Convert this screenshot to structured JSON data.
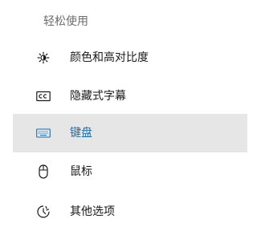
{
  "section": {
    "title": "轻松使用"
  },
  "nav": {
    "items": [
      {
        "label": "颜色和高对比度",
        "icon": "brightness-icon",
        "selected": false
      },
      {
        "label": "隐藏式字幕",
        "icon": "closed-caption-icon",
        "selected": false
      },
      {
        "label": "键盘",
        "icon": "keyboard-icon",
        "selected": true
      },
      {
        "label": "鼠标",
        "icon": "mouse-icon",
        "selected": false
      },
      {
        "label": "其他选项",
        "icon": "other-options-icon",
        "selected": false
      }
    ]
  },
  "colors": {
    "selected_bg": "#e6e6e6",
    "accent": "#1a6fb3",
    "text": "#1a1a1a",
    "section_title": "#6d6d6d"
  }
}
